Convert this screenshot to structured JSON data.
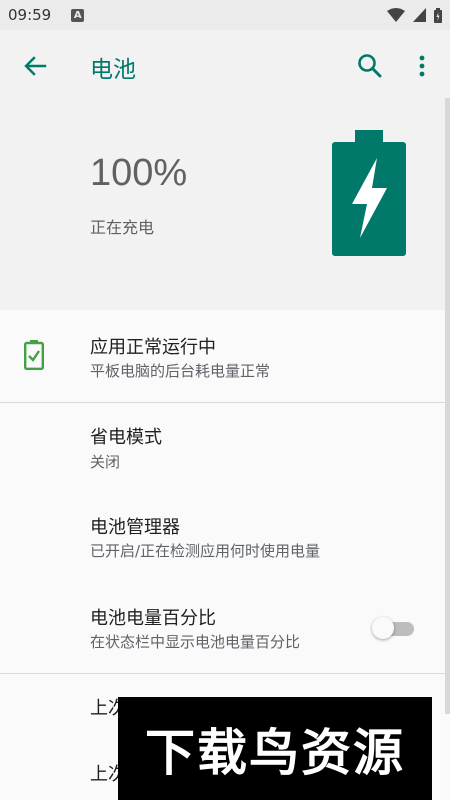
{
  "status_bar": {
    "time": "09:59",
    "notification_glyph": "A",
    "icons": [
      "wifi-icon",
      "signal-icon",
      "battery-icon"
    ]
  },
  "app_bar": {
    "title": "电池",
    "icons": [
      "back-arrow-icon",
      "search-icon",
      "more-vert-icon"
    ]
  },
  "hero": {
    "percent": "100%",
    "status": "正在充电",
    "battery_level": 1.0
  },
  "settings": [
    {
      "title": "应用正常运行中",
      "subtitle": "平板电脑的后台耗电量正常",
      "icon": "battery-ok-icon"
    },
    {
      "title": "省电模式",
      "subtitle": "关闭"
    },
    {
      "title": "电池管理器",
      "subtitle": "已开启/正在检测应用何时使用电量"
    },
    {
      "title": "电池电量百分比",
      "subtitle": "在状态栏中显示电池电量百分比",
      "toggle_on": false
    },
    {
      "title_partial": "上次"
    },
    {
      "title_partial": "上次"
    }
  ],
  "watermark": {
    "text": "下载鸟资源"
  },
  "colors": {
    "accent": "#00796b",
    "battery_ok": "#43a047",
    "background": "#fafafa"
  }
}
